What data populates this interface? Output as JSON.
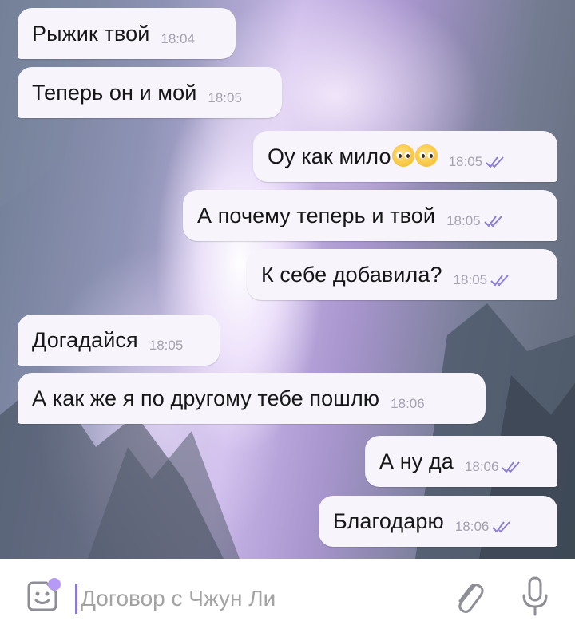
{
  "conversation": {
    "messages": [
      {
        "direction": "incoming",
        "text": "Рыжик твой",
        "time": "18:04"
      },
      {
        "direction": "incoming",
        "text": "Теперь он и мой",
        "time": "18:05"
      },
      {
        "direction": "outgoing",
        "text": "Оу как мило",
        "emoji": [
          "pleading-face",
          "pleading-face"
        ],
        "time": "18:05",
        "status": "read"
      },
      {
        "direction": "outgoing",
        "text": "А почему теперь и твой",
        "time": "18:05",
        "status": "read"
      },
      {
        "direction": "outgoing",
        "text": "К себе добавила?",
        "time": "18:05",
        "status": "read"
      },
      {
        "direction": "incoming",
        "text": "Догадайся",
        "time": "18:05"
      },
      {
        "direction": "incoming",
        "text": "А как же я по другому тебе пошлю",
        "time": "18:06"
      },
      {
        "direction": "outgoing",
        "text": "А ну да",
        "time": "18:06",
        "status": "read"
      },
      {
        "direction": "outgoing",
        "text": "Благодарю",
        "time": "18:06",
        "status": "read"
      }
    ]
  },
  "composer": {
    "placeholder": "Договор с Чжун Ли",
    "left_icon": "sticker-emoji-icon",
    "attach_icon": "paperclip-icon",
    "mic_icon": "microphone-icon"
  },
  "colors": {
    "bubble": "#f7f4fb",
    "time": "#a6a2b2",
    "read_ticks": "#8c7fd8",
    "accent": "#a78bf0"
  }
}
